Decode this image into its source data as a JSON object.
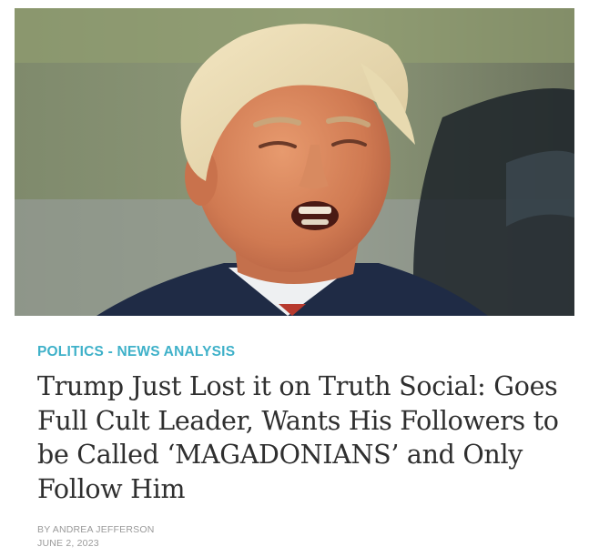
{
  "article": {
    "category": "POLITICS - NEWS ANALYSIS",
    "headline": "Trump Just Lost it on Truth Social: Goes Full Cult Leader, Wants His Followers to be Called ‘MAGADONIANS’ and Only Follow Him",
    "author": "BY ANDREA JEFFERSON",
    "date": "JUNE 2, 2023"
  },
  "colors": {
    "category": "#3fb1c9",
    "headline": "#2f2f2f",
    "meta": "#9a9a9a"
  }
}
